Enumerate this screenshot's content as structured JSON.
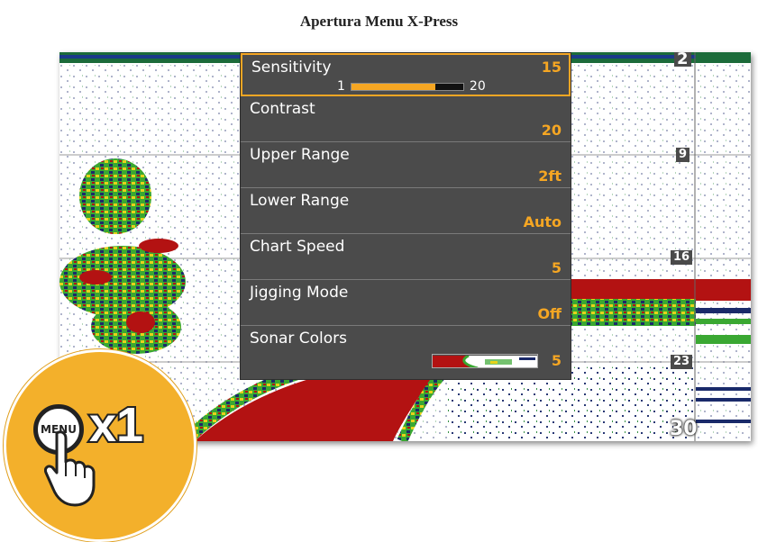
{
  "title": "Apertura Menu X-Press",
  "depth_labels": [
    "2",
    "9",
    "16",
    "23",
    "30"
  ],
  "menu": {
    "items": [
      {
        "label": "Sensitivity",
        "value": "15",
        "selected": true
      },
      {
        "label": "Contrast",
        "value": "20"
      },
      {
        "label": "Upper Range",
        "value": "2ft"
      },
      {
        "label": "Lower Range",
        "value": "Auto"
      },
      {
        "label": "Chart Speed",
        "value": "5"
      },
      {
        "label": "Jigging Mode",
        "value": "Off"
      },
      {
        "label": "Sonar Colors",
        "value": "5"
      }
    ],
    "slider": {
      "min": "1",
      "max": "20",
      "level": 0.75
    }
  },
  "badge": {
    "button_label": "MENU",
    "count": "x1"
  },
  "colors": {
    "accent": "#f5a623",
    "menu_bg": "#4b4b4b",
    "sonar_red": "#b31212",
    "sonar_green": "#3aa832",
    "sonar_yellow": "#e6d21a",
    "badge": "#f3b02b"
  }
}
